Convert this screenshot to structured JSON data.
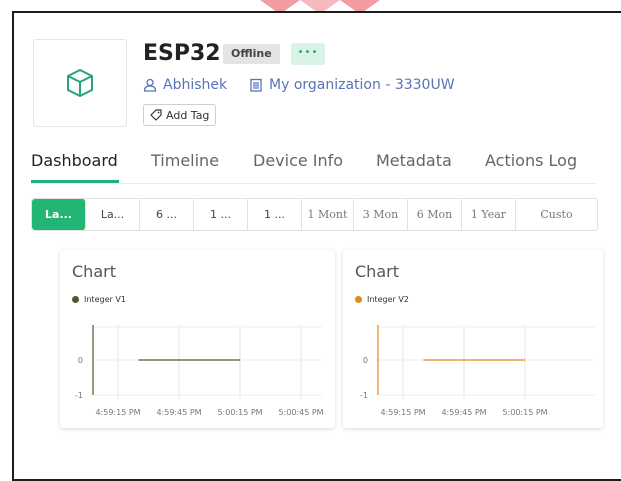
{
  "colors": {
    "accent": "#22b573",
    "link": "#5a73b8",
    "series_v1": "#4a5a2a",
    "series_v2": "#e08a1e"
  },
  "device": {
    "name": "ESP32",
    "status": "Offline",
    "more_label": "•••",
    "owner": "Abhishek",
    "organization": "My organization - 3330UW",
    "add_tag_label": "Add Tag",
    "icon": "cube-icon"
  },
  "tabs": [
    {
      "label": "Dashboard",
      "active": true
    },
    {
      "label": "Timeline"
    },
    {
      "label": "Device Info"
    },
    {
      "label": "Metadata"
    },
    {
      "label": "Actions Log"
    }
  ],
  "time_ranges": [
    {
      "label": "La...",
      "active": true
    },
    {
      "label": "La..."
    },
    {
      "label": "6 ..."
    },
    {
      "label": "1 ..."
    },
    {
      "label": "1 ..."
    },
    {
      "label": "1 Mont"
    },
    {
      "label": "3 Mon"
    },
    {
      "label": "6 Mon"
    },
    {
      "label": "1 Year"
    },
    {
      "label": "Custo"
    }
  ],
  "chart_data": [
    {
      "type": "line",
      "title": "Chart",
      "series": [
        {
          "name": "Integer V1",
          "values": [
            0,
            0
          ]
        }
      ],
      "x": [
        "4:59:25 PM",
        "5:00:15 PM"
      ],
      "x_ticks": [
        "4:59:15 PM",
        "4:59:45 PM",
        "5:00:15 PM",
        "5:00:45 PM"
      ],
      "y_ticks": [
        "0",
        "-1"
      ],
      "ylim": [
        -1,
        1
      ],
      "grid": true,
      "legend": "top-left"
    },
    {
      "type": "line",
      "title": "Chart",
      "series": [
        {
          "name": "Integer V2",
          "values": [
            0,
            0
          ]
        }
      ],
      "x": [
        "4:59:25 PM",
        "5:00:15 PM"
      ],
      "x_ticks": [
        "4:59:15 PM",
        "4:59:45 PM",
        "5:00:15 PM"
      ],
      "y_ticks": [
        "0",
        "-1"
      ],
      "ylim": [
        -1,
        1
      ],
      "grid": true,
      "legend": "top-left"
    }
  ]
}
